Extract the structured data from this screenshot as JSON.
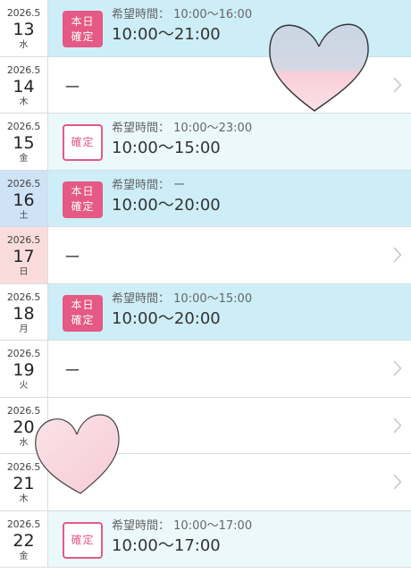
{
  "rows": [
    {
      "ym": "2026.5",
      "day": "13",
      "dow": "水",
      "dayType": "weekday",
      "status": "today",
      "badge_line1": "本日",
      "badge_line2": "確定",
      "requested_label": "希望時間：",
      "requested": "10:00〜16:00",
      "confirmed": "10:00〜21:00",
      "empty": "",
      "chevron": false
    },
    {
      "ym": "2026.5",
      "day": "14",
      "dow": "木",
      "dayType": "weekday",
      "status": "none",
      "badge_line1": "",
      "badge_line2": "",
      "requested_label": "",
      "requested": "",
      "confirmed": "",
      "empty": "ー",
      "chevron": true
    },
    {
      "ym": "2026.5",
      "day": "15",
      "dow": "金",
      "dayType": "weekday",
      "status": "confirmed",
      "badge_line1": "確定",
      "badge_line2": "",
      "requested_label": "希望時間：",
      "requested": "10:00〜23:00",
      "confirmed": "10:00〜15:00",
      "empty": "",
      "chevron": false
    },
    {
      "ym": "2026.5",
      "day": "16",
      "dow": "土",
      "dayType": "saturday",
      "status": "today",
      "badge_line1": "本日",
      "badge_line2": "確定",
      "requested_label": "希望時間：",
      "requested": "ー",
      "confirmed": "10:00〜20:00",
      "empty": "",
      "chevron": false
    },
    {
      "ym": "2026.5",
      "day": "17",
      "dow": "日",
      "dayType": "sunday",
      "status": "none",
      "badge_line1": "",
      "badge_line2": "",
      "requested_label": "",
      "requested": "",
      "confirmed": "",
      "empty": "ー",
      "chevron": true
    },
    {
      "ym": "2026.5",
      "day": "18",
      "dow": "月",
      "dayType": "weekday",
      "status": "today",
      "badge_line1": "本日",
      "badge_line2": "確定",
      "requested_label": "希望時間：",
      "requested": "10:00〜15:00",
      "confirmed": "10:00〜20:00",
      "empty": "",
      "chevron": false
    },
    {
      "ym": "2026.5",
      "day": "19",
      "dow": "火",
      "dayType": "weekday",
      "status": "none",
      "badge_line1": "",
      "badge_line2": "",
      "requested_label": "",
      "requested": "",
      "confirmed": "",
      "empty": "ー",
      "chevron": true
    },
    {
      "ym": "2026.5",
      "day": "20",
      "dow": "水",
      "dayType": "weekday",
      "status": "blank",
      "badge_line1": "",
      "badge_line2": "",
      "requested_label": "",
      "requested": "",
      "confirmed": "",
      "empty": "",
      "chevron": true
    },
    {
      "ym": "2026.5",
      "day": "21",
      "dow": "木",
      "dayType": "weekday",
      "status": "blank",
      "badge_line1": "",
      "badge_line2": "",
      "requested_label": "",
      "requested": "",
      "confirmed": "",
      "empty": "",
      "chevron": true
    },
    {
      "ym": "2026.5",
      "day": "22",
      "dow": "金",
      "dayType": "weekday",
      "status": "confirmed",
      "badge_line1": "確定",
      "badge_line2": "",
      "requested_label": "希望時間：",
      "requested": "10:00〜17:00",
      "confirmed": "10:00〜17:00",
      "empty": "",
      "chevron": false
    }
  ],
  "colors": {
    "accent": "#e45985",
    "row_today": "#cdeef7",
    "row_confirmed": "#ebf8fc",
    "saturday": "#cfe3f7",
    "sunday": "#fbdcdc",
    "divider": "#d6dde2"
  },
  "icons": {
    "chevron": "chevron-right-icon",
    "decoration": "heart-icon"
  }
}
